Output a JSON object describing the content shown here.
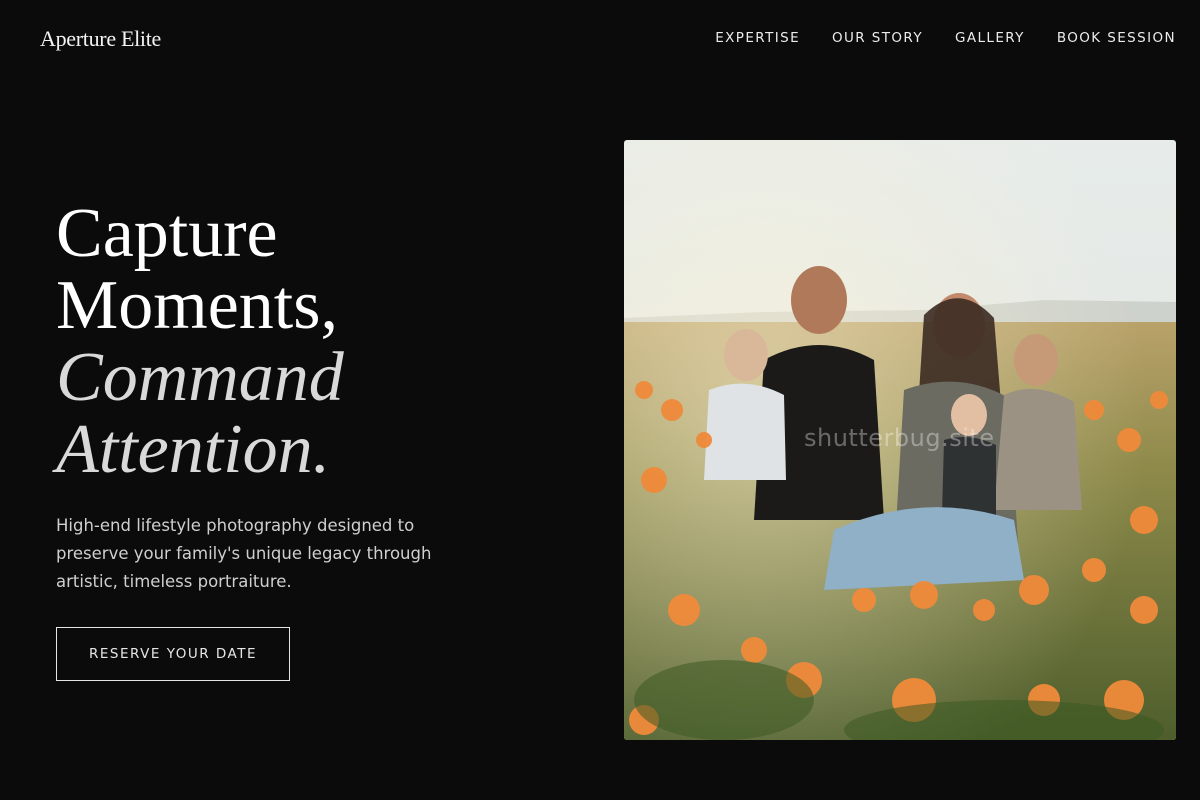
{
  "header": {
    "brand": "Aperture Elite",
    "nav": [
      {
        "label": "EXPERTISE"
      },
      {
        "label": "OUR STORY"
      },
      {
        "label": "GALLERY"
      },
      {
        "label": "BOOK SESSION"
      }
    ]
  },
  "hero": {
    "headline_line1": "Capture",
    "headline_line2": "Moments,",
    "headline_line3": "Command",
    "headline_line4": "Attention.",
    "description": "High-end lifestyle photography designed to preserve your family's unique legacy through artistic, timeless portraiture.",
    "cta_label": "RESERVE YOUR DATE",
    "image_watermark": "shutterbug.site"
  },
  "colors": {
    "background": "#0b0b0c",
    "text": "#ffffff",
    "muted_text": "#cfcfcf",
    "flowers": "#f08a3a"
  }
}
